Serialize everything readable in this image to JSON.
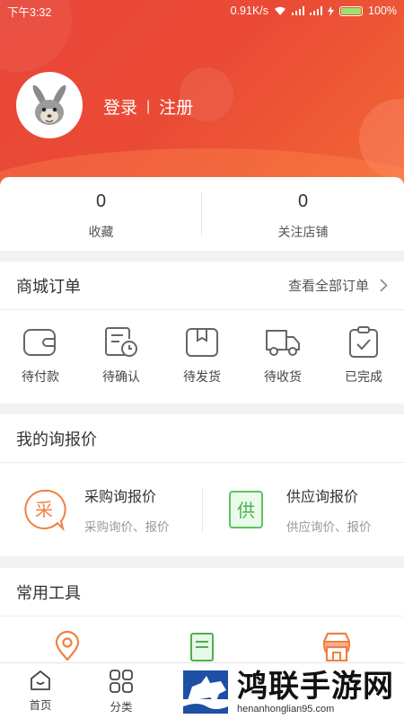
{
  "status_bar": {
    "time": "下午3:32",
    "speed": "0.91K/s",
    "battery": "100%"
  },
  "user": {
    "login": "登录",
    "separator": "|",
    "register": "注册"
  },
  "stats": [
    {
      "value": "0",
      "label": "收藏"
    },
    {
      "value": "0",
      "label": "关注店铺"
    }
  ],
  "orders": {
    "title": "商城订单",
    "view_all": "查看全部订单",
    "items": [
      {
        "label": "待付款",
        "icon": "wallet-icon"
      },
      {
        "label": "待确认",
        "icon": "pending-confirm-icon"
      },
      {
        "label": "待发货",
        "icon": "package-icon"
      },
      {
        "label": "待收货",
        "icon": "truck-icon"
      },
      {
        "label": "已完成",
        "icon": "clipboard-check-icon"
      }
    ]
  },
  "inquiry": {
    "title": "我的询报价",
    "items": [
      {
        "badge": "采",
        "title": "采购询报价",
        "subtitle": "采购询价、报价"
      },
      {
        "badge": "供",
        "title": "供应询报价",
        "subtitle": "供应询价、报价"
      }
    ]
  },
  "tools": {
    "title": "常用工具",
    "icons": [
      "location-icon",
      "document-icon",
      "shop-icon"
    ]
  },
  "tabbar": [
    {
      "label": "首页",
      "icon": "home-icon"
    },
    {
      "label": "分类",
      "icon": "category-icon"
    }
  ],
  "watermark": {
    "text": "鸿联手游网",
    "url": "henanhonglian95.com"
  },
  "colors": {
    "brand_red": "#e8473a",
    "accent_orange": "#f26a35",
    "green": "#4caf50"
  }
}
